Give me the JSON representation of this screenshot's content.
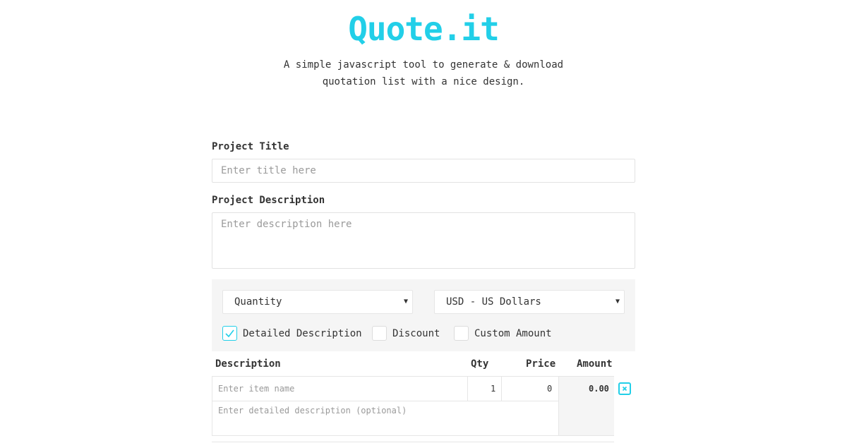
{
  "header": {
    "logo": "Quote.it",
    "tagline_line1": "A simple javascript tool to generate & download",
    "tagline_line2": "quotation list with a nice design."
  },
  "form": {
    "title_label": "Project Title",
    "title_placeholder": "Enter title here",
    "description_label": "Project Description",
    "description_placeholder": "Enter description here"
  },
  "options": {
    "type_select": "Quantity",
    "currency_select": "USD - US Dollars",
    "checkboxes": [
      {
        "label": "Detailed Description",
        "checked": true
      },
      {
        "label": "Discount",
        "checked": false
      },
      {
        "label": "Custom Amount",
        "checked": false
      }
    ]
  },
  "table": {
    "headers": [
      "Description",
      "Qty",
      "Price",
      "Amount"
    ],
    "rows": [
      {
        "item_placeholder": "Enter item name",
        "detail_placeholder": "Enter detailed description (optional)",
        "qty": "1",
        "price": "0",
        "amount": "0.00"
      }
    ]
  },
  "colors": {
    "accent": "#22cfe8",
    "panel": "#f5f5f5",
    "border": "#e2e2e2"
  },
  "icons": {
    "check": "check-icon",
    "remove": "remove-item-icon",
    "dropdown": "caret-down-icon"
  }
}
